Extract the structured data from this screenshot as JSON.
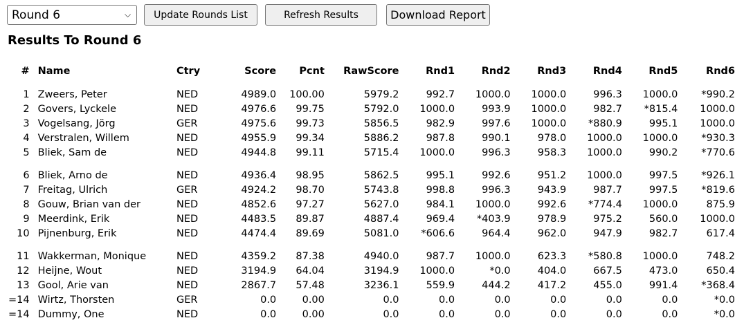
{
  "toolbar": {
    "round_select_value": "Round 6",
    "update_label": "Update Rounds List",
    "refresh_label": "Refresh Results",
    "download_label": "Download Report"
  },
  "heading": "Results To Round 6",
  "table": {
    "columns": [
      "#",
      "Name",
      "Ctry",
      "Score",
      "Pcnt",
      "RawScore",
      "Rnd1",
      "Rnd2",
      "Rnd3",
      "Rnd4",
      "Rnd5",
      "Rnd6"
    ],
    "rows": [
      [
        "1",
        "Zweers, Peter",
        "NED",
        "4989.0",
        "100.00",
        "5979.2",
        "992.7",
        "1000.0",
        "1000.0",
        "996.3",
        "1000.0",
        "*990.2"
      ],
      [
        "2",
        "Govers, Lyckele",
        "NED",
        "4976.6",
        "99.75",
        "5792.0",
        "1000.0",
        "993.9",
        "1000.0",
        "982.7",
        "*815.4",
        "1000.0"
      ],
      [
        "3",
        "Vogelsang, Jörg",
        "GER",
        "4975.6",
        "99.73",
        "5856.5",
        "982.9",
        "997.6",
        "1000.0",
        "*880.9",
        "995.1",
        "1000.0"
      ],
      [
        "4",
        "Verstralen, Willem",
        "NED",
        "4955.9",
        "99.34",
        "5886.2",
        "987.8",
        "990.1",
        "978.0",
        "1000.0",
        "1000.0",
        "*930.3"
      ],
      [
        "5",
        "Bliek, Sam de",
        "NED",
        "4944.8",
        "99.11",
        "5715.4",
        "1000.0",
        "996.3",
        "958.3",
        "1000.0",
        "990.2",
        "*770.6"
      ],
      [
        "6",
        "Bliek, Arno de",
        "NED",
        "4936.4",
        "98.95",
        "5862.5",
        "995.1",
        "992.6",
        "951.2",
        "1000.0",
        "997.5",
        "*926.1"
      ],
      [
        "7",
        "Freitag, Ulrich",
        "GER",
        "4924.2",
        "98.70",
        "5743.8",
        "998.8",
        "996.3",
        "943.9",
        "987.7",
        "997.5",
        "*819.6"
      ],
      [
        "8",
        "Gouw, Brian van der",
        "NED",
        "4852.6",
        "97.27",
        "5627.0",
        "984.1",
        "1000.0",
        "992.6",
        "*774.4",
        "1000.0",
        "875.9"
      ],
      [
        "9",
        "Meerdink, Erik",
        "NED",
        "4483.5",
        "89.87",
        "4887.4",
        "969.4",
        "*403.9",
        "978.9",
        "975.2",
        "560.0",
        "1000.0"
      ],
      [
        "10",
        "Pijnenburg, Erik",
        "NED",
        "4474.4",
        "89.69",
        "5081.0",
        "*606.6",
        "964.4",
        "962.0",
        "947.9",
        "982.7",
        "617.4"
      ],
      [
        "11",
        "Wakkerman, Monique",
        "NED",
        "4359.2",
        "87.38",
        "4940.0",
        "987.7",
        "1000.0",
        "623.3",
        "*580.8",
        "1000.0",
        "748.2"
      ],
      [
        "12",
        "Heijne, Wout",
        "NED",
        "3194.9",
        "64.04",
        "3194.9",
        "1000.0",
        "*0.0",
        "404.0",
        "667.5",
        "473.0",
        "650.4"
      ],
      [
        "13",
        "Gool, Arie van",
        "NED",
        "2867.7",
        "57.48",
        "3236.1",
        "559.9",
        "444.2",
        "417.2",
        "455.0",
        "991.4",
        "*368.4"
      ],
      [
        "=14",
        "Wirtz, Thorsten",
        "GER",
        "0.0",
        "0.00",
        "0.0",
        "0.0",
        "0.0",
        "0.0",
        "0.0",
        "0.0",
        "*0.0"
      ],
      [
        "=14",
        "Dummy, One",
        "NED",
        "0.0",
        "0.00",
        "0.0",
        "0.0",
        "0.0",
        "0.0",
        "0.0",
        "0.0",
        "*0.0"
      ]
    ]
  }
}
